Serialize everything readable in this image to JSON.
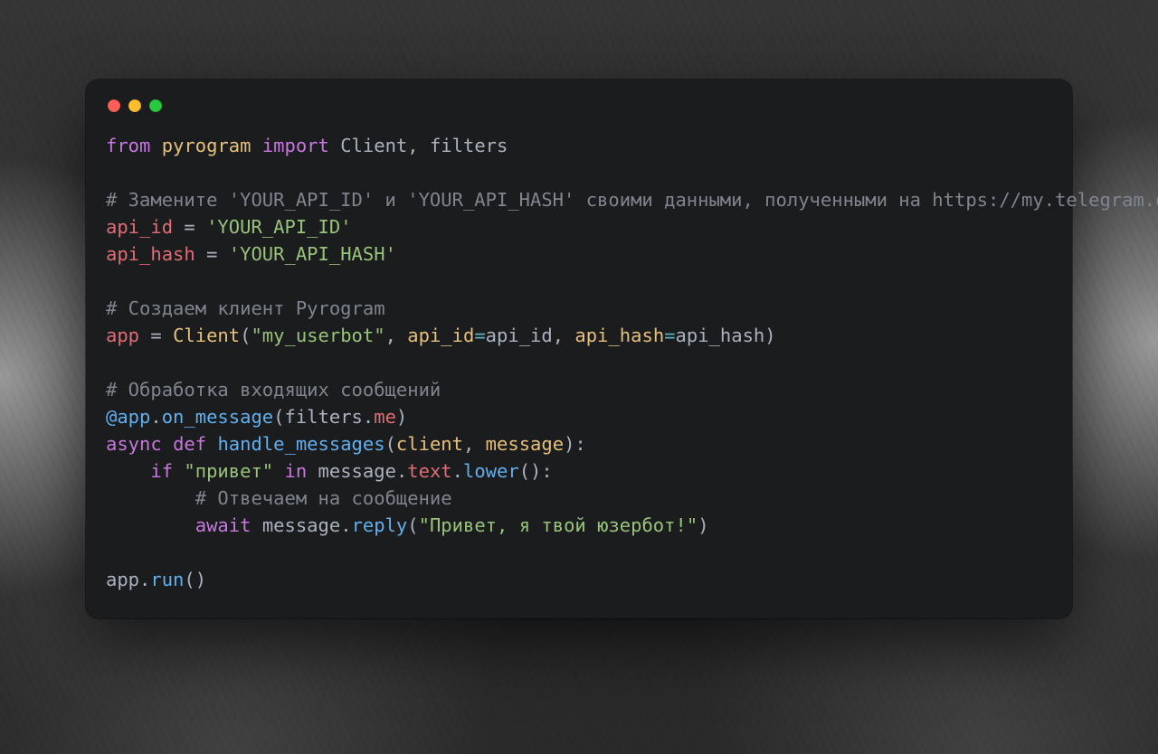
{
  "colors": {
    "window_bg": "#1b1c1e",
    "red": "#ff5f56",
    "yellow": "#ffbd2e",
    "green": "#27c93f"
  },
  "code": {
    "l1_from": "from",
    "l1_module": "pyrogram",
    "l1_import": "import",
    "l1_names": "Client, filters",
    "l3_comment": "# Замените 'YOUR_API_ID' и 'YOUR_API_HASH' своими данными, полученными на https://my.telegram.org/apps",
    "l4_var": "api_id",
    "l4_eq": " = ",
    "l4_str": "'YOUR_API_ID'",
    "l5_var": "api_hash",
    "l5_eq": " = ",
    "l5_str": "'YOUR_API_HASH'",
    "l7_comment": "# Создаем клиент Pyrogram",
    "l8_var": "app",
    "l8_eq": " = ",
    "l8_class": "Client",
    "l8_open": "(",
    "l8_arg1": "\"my_userbot\"",
    "l8_comma1": ", ",
    "l8_kw1": "api_id",
    "l8_assign1": "=",
    "l8_val1": "api_id",
    "l8_comma2": ", ",
    "l8_kw2": "api_hash",
    "l8_assign2": "=",
    "l8_val2": "api_hash",
    "l8_close": ")",
    "l10_comment": "# Обработка входящих сообщений",
    "l11_at": "@app",
    "l11_dot": ".",
    "l11_on": "on_message",
    "l11_open": "(",
    "l11_filters": "filters",
    "l11_dot2": ".",
    "l11_me": "me",
    "l11_close": ")",
    "l12_async": "async",
    "l12_def": "def",
    "l12_fname": "handle_messages",
    "l12_open": "(",
    "l12_p1": "client",
    "l12_comma": ", ",
    "l12_p2": "message",
    "l12_close": "):",
    "l13_indent": "    ",
    "l13_if": "if",
    "l13_str": "\"привет\"",
    "l13_in": "in",
    "l13_msg": "message",
    "l13_dot": ".",
    "l13_text": "text",
    "l13_dot2": ".",
    "l13_lower": "lower",
    "l13_call": "():",
    "l14_indent": "        ",
    "l14_comment": "# Отвечаем на сообщение",
    "l15_indent": "        ",
    "l15_await": "await",
    "l15_msg": "message",
    "l15_dot": ".",
    "l15_reply": "reply",
    "l15_open": "(",
    "l15_str": "\"Привет, я твой юзербот!\"",
    "l15_close": ")",
    "l17_app": "app",
    "l17_dot": ".",
    "l17_run": "run",
    "l17_call": "()"
  }
}
